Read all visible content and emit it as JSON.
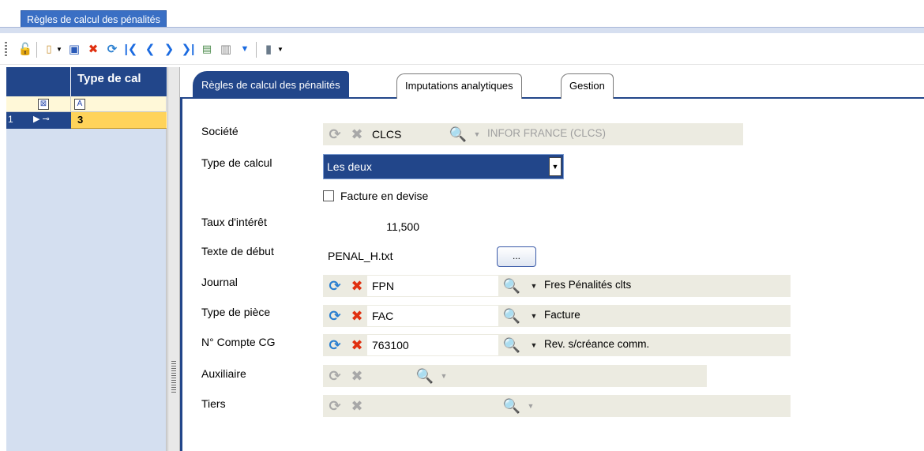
{
  "window": {
    "tab_title": "Règles de calcul des pénalités"
  },
  "toolbar": {
    "icons": [
      "unlock-icon",
      "new-document-icon",
      "dropdown-icon",
      "save-icon",
      "delete-icon",
      "refresh-icon",
      "first-record-icon",
      "previous-record-icon",
      "next-record-icon",
      "last-record-icon",
      "preview-icon",
      "print-icon",
      "filter-dropdown-icon",
      "export-icon",
      "dropdown-icon"
    ]
  },
  "grid": {
    "column_header": "Type de cal",
    "rows": [
      {
        "row_number": "1",
        "type_de_calcul": "3"
      }
    ]
  },
  "tabs": [
    {
      "label": "Règles de calcul des pénalités",
      "active": true
    },
    {
      "label": "Imputations analytiques",
      "active": false
    },
    {
      "label": "Gestion",
      "active": false
    }
  ],
  "form": {
    "societe": {
      "label": "Société",
      "code": "CLCS",
      "description": "INFOR FRANCE (CLCS)"
    },
    "type_calcul": {
      "label": "Type de calcul",
      "value": "Les deux"
    },
    "facture_devise": {
      "label": "Facture en devise",
      "checked": false
    },
    "taux_interet": {
      "label": "Taux d'intérêt",
      "value": "11,500"
    },
    "texte_debut": {
      "label": "Texte de début",
      "value": "PENAL_H.txt",
      "browse_label": "..."
    },
    "journal": {
      "label": "Journal",
      "code": "FPN",
      "description": "Fres Pénalités clts"
    },
    "type_piece": {
      "label": "Type de pièce",
      "code": "FAC",
      "description": "Facture"
    },
    "compte_cg": {
      "label": "N° Compte CG",
      "code": "763100",
      "description": "Rev. s/créance comm."
    },
    "auxiliaire": {
      "label": "Auxiliaire",
      "code": "",
      "description": ""
    },
    "tiers": {
      "label": "Tiers",
      "code": "",
      "description": ""
    }
  },
  "colors": {
    "accent": "#22468a",
    "selected_row": "#ffd35a",
    "field_strip": "#ecebe1"
  }
}
